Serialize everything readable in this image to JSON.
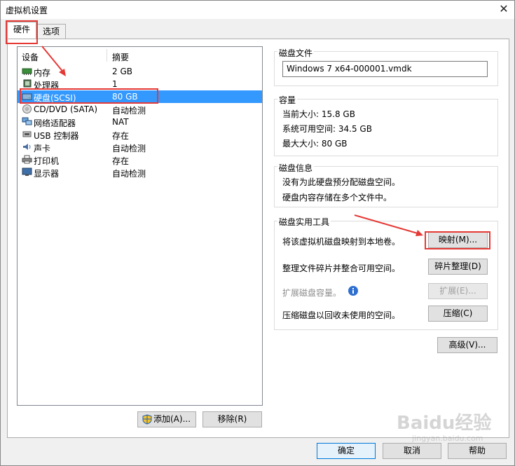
{
  "window": {
    "title": "虚拟机设置",
    "close_glyph": "✕"
  },
  "tabs": [
    {
      "label": "硬件",
      "active": true
    },
    {
      "label": "选项",
      "active": false
    }
  ],
  "device_list": {
    "headers": {
      "device": "设备",
      "summary": "摘要"
    },
    "rows": [
      {
        "icon": "memory-icon",
        "name": "内存",
        "summary": "2 GB"
      },
      {
        "icon": "processor-icon",
        "name": "处理器",
        "summary": "1"
      },
      {
        "icon": "hard-disk-icon",
        "name": "硬盘(SCSI)",
        "summary": "80 GB",
        "selected": true
      },
      {
        "icon": "cd-dvd-icon",
        "name": "CD/DVD (SATA)",
        "summary": "自动检测"
      },
      {
        "icon": "network-adapter-icon",
        "name": "网络适配器",
        "summary": "NAT"
      },
      {
        "icon": "usb-icon",
        "name": "USB 控制器",
        "summary": "存在"
      },
      {
        "icon": "sound-card-icon",
        "name": "声卡",
        "summary": "自动检测"
      },
      {
        "icon": "printer-icon",
        "name": "打印机",
        "summary": "存在"
      },
      {
        "icon": "display-icon",
        "name": "显示器",
        "summary": "自动检测"
      }
    ]
  },
  "list_buttons": {
    "add": "添加(A)...",
    "remove": "移除(R)"
  },
  "disk_file": {
    "label": "磁盘文件",
    "value": "Windows 7 x64-000001.vmdk"
  },
  "capacity": {
    "label": "容量",
    "current_size": "当前大小: 15.8 GB",
    "system_free": "系统可用空间: 34.5 GB",
    "max_size": "最大大小: 80 GB"
  },
  "disk_info": {
    "label": "磁盘信息",
    "line1": "没有为此硬盘预分配磁盘空间。",
    "line2": "硬盘内容存储在多个文件中。"
  },
  "disk_utilities": {
    "label": "磁盘实用工具",
    "map_desc": "将该虚拟机磁盘映射到本地卷。",
    "map_btn": "映射(M)...",
    "defrag_desc": "整理文件碎片并整合可用空间。",
    "defrag_btn": "碎片整理(D)",
    "expand_desc": "扩展磁盘容量。",
    "expand_btn": "扩展(E)...",
    "compact_desc": "压缩磁盘以回收未使用的空间。",
    "compact_btn": "压缩(C)"
  },
  "advanced_btn": "高级(V)...",
  "footer": {
    "ok": "确定",
    "cancel": "取消",
    "help": "帮助"
  },
  "watermark": {
    "brand": "Baidu经验",
    "url": "jingyan.baidu.com"
  },
  "colors": {
    "selection": "#3399ff",
    "highlight_box": "#e53935",
    "accent": "#0078d7"
  }
}
